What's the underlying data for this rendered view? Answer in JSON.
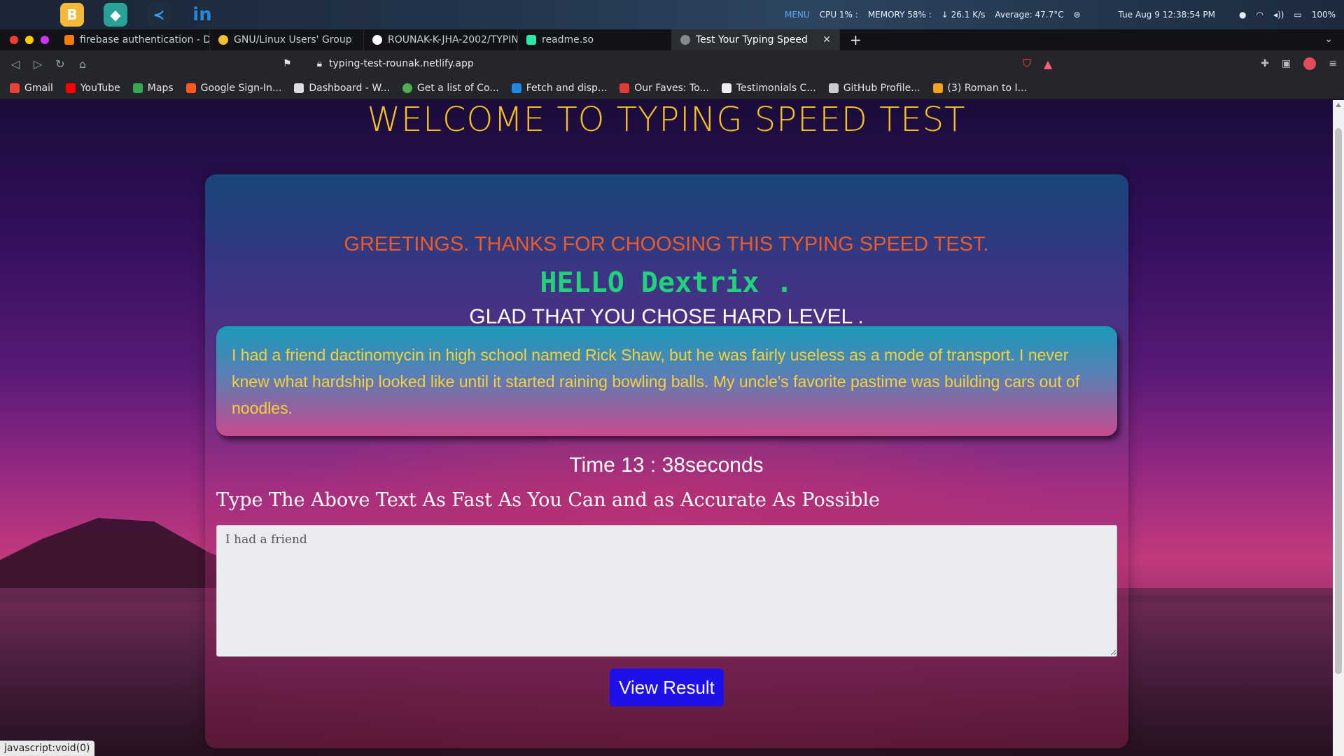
{
  "system": {
    "menu_label": "MENU",
    "cpu": "CPU   1% :",
    "memory": "MEMORY   58% :",
    "net": "↓ 26.1 K/s",
    "temp": "Average: 47.7°C",
    "clock": "Tue Aug  9   12:38:54 PM",
    "battery": "100%"
  },
  "tabs": [
    {
      "label": "firebase authentication - Def",
      "color": "#f57c00"
    },
    {
      "label": "GNU/Linux Users' Group",
      "color": "#f2c12e"
    },
    {
      "label": "ROUNAK-K-JHA-2002/TYPING",
      "color": "#ffffff"
    },
    {
      "label": "readme.so",
      "color": "#2ee6a6"
    },
    {
      "label": "Test Your Typing Speed",
      "color": "#aaaaaa"
    }
  ],
  "address": {
    "url": "typing-test-rounak.netlify.app"
  },
  "bookmarks": [
    {
      "label": "Gmail",
      "color": "#ea4335"
    },
    {
      "label": "YouTube",
      "color": "#ff0000"
    },
    {
      "label": "Maps",
      "color": "#34a853"
    },
    {
      "label": "Google Sign-In...",
      "color": "#ff5722"
    },
    {
      "label": "Dashboard - W...",
      "color": "#dddddd"
    },
    {
      "label": "Get a list of Co...",
      "color": "#4caf50"
    },
    {
      "label": "Fetch and disp...",
      "color": "#1e88e5"
    },
    {
      "label": "Our Faves: To...",
      "color": "#e53935"
    },
    {
      "label": "Testimonials C...",
      "color": "#eeeeee"
    },
    {
      "label": "GitHub Profile...",
      "color": "#cccccc"
    },
    {
      "label": "(3) Roman to I...",
      "color": "#f4a11d"
    }
  ],
  "page": {
    "title": "WELCOME TO TYPING SPEED TEST",
    "greeting": "GREETINGS. THANKS FOR CHOOSING THIS TYPING SPEED TEST.",
    "hello": "HELLO Dextrix .",
    "level": "GLAD THAT YOU CHOSE HARD LEVEL .",
    "quote": "I had a friend dactinomycin in high school named Rick Shaw, but he was fairly useless as a mode of transport. I never knew what hardship looked like until it started raining bowling balls. My uncle's favorite pastime was building cars out of noodles.",
    "timer": "Time 13 : 38seconds",
    "instruction": "Type The Above Text As Fast As You Can and as Accurate As Possible",
    "typed_value": "I had a friend",
    "result_button": "View Result"
  },
  "status_tip": "javascript:void(0)"
}
